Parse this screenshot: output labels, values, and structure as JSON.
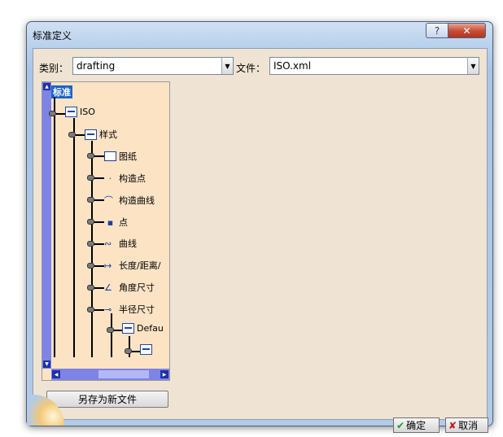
{
  "window": {
    "title": "标准定义",
    "help_label": "?",
    "close_label": "✕"
  },
  "filters": {
    "category_label": "类别：",
    "category_value": "drafting",
    "file_label": "文件：",
    "file_value": "ISO.xml"
  },
  "tree": {
    "root": "标准",
    "items": [
      {
        "label": "ISO",
        "icon": "doc-icon"
      },
      {
        "label": "样式",
        "icon": "doc-icon"
      },
      {
        "label": "图纸",
        "icon": "sheet-icon"
      },
      {
        "label": "构造点",
        "icon": "construction-point-icon"
      },
      {
        "label": "构造曲线",
        "icon": "construction-curve-icon"
      },
      {
        "label": "点",
        "icon": "point-icon"
      },
      {
        "label": "曲线",
        "icon": "curve-icon"
      },
      {
        "label": "长度/距离/",
        "icon": "length-dimension-icon"
      },
      {
        "label": "角度尺寸",
        "icon": "angle-dimension-icon"
      },
      {
        "label": "半径尺寸",
        "icon": "radius-dimension-icon"
      },
      {
        "label": "Defau",
        "icon": "doc-icon"
      },
      {
        "label": "",
        "icon": "doc-icon"
      }
    ]
  },
  "buttons": {
    "save_as": "另存为新文件",
    "ok": "确定",
    "cancel": "取消"
  }
}
